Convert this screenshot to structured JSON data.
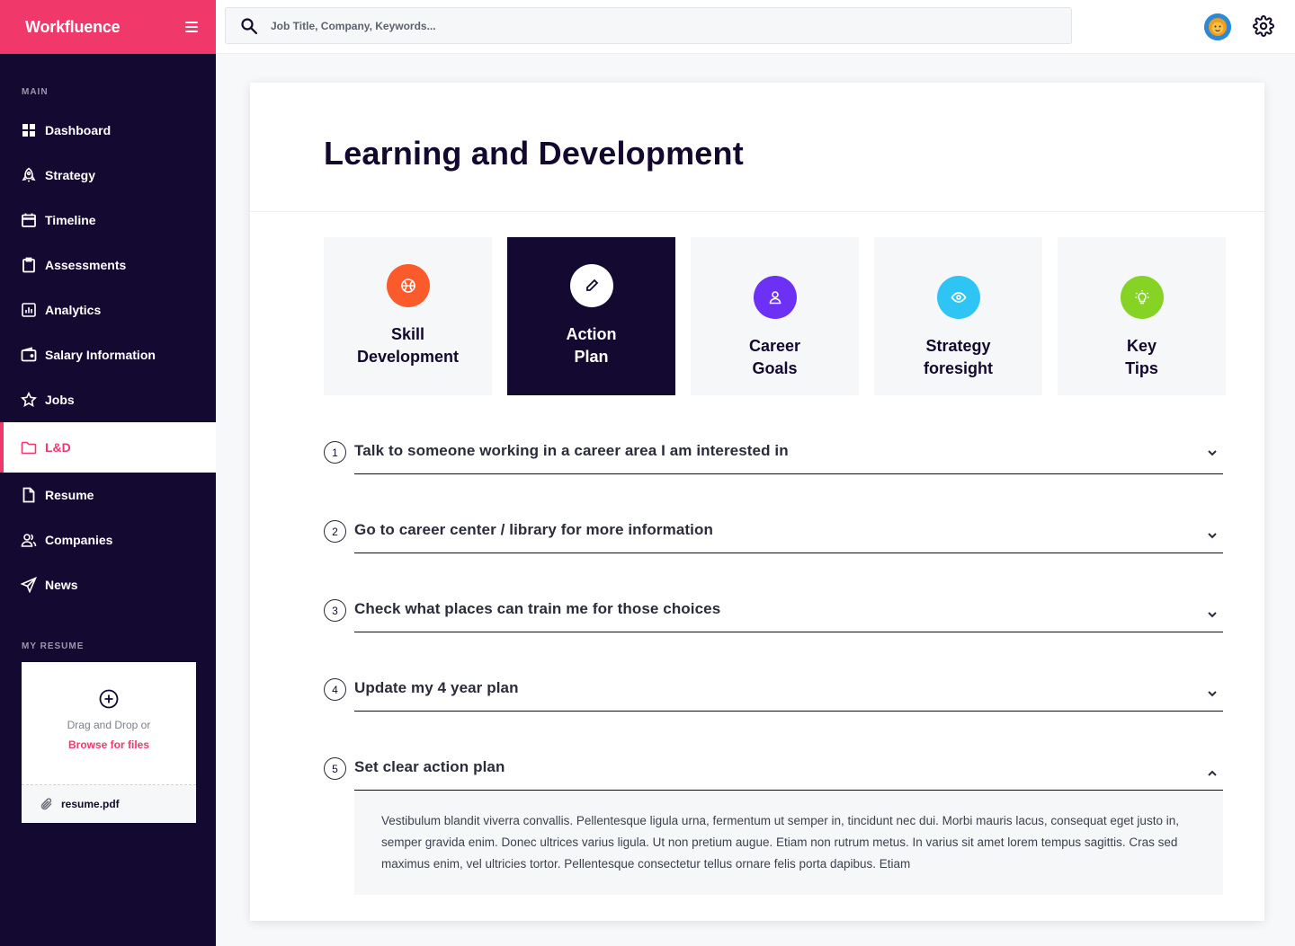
{
  "app": {
    "brand": "Workfluence"
  },
  "search": {
    "placeholder": "Job Title, Company, Keywords..."
  },
  "sidebar": {
    "main_label": "MAIN",
    "items": [
      {
        "label": "Dashboard",
        "icon": "grid-icon"
      },
      {
        "label": "Strategy",
        "icon": "rocket-icon"
      },
      {
        "label": "Timeline",
        "icon": "calendar-icon"
      },
      {
        "label": "Assessments",
        "icon": "clipboard-icon"
      },
      {
        "label": "Analytics",
        "icon": "bar-chart-icon"
      },
      {
        "label": "Salary Information",
        "icon": "wallet-icon"
      },
      {
        "label": "Jobs",
        "icon": "star-icon"
      },
      {
        "label": "L&D",
        "icon": "folder-icon",
        "active": true
      },
      {
        "label": "Resume",
        "icon": "file-icon"
      },
      {
        "label": "Companies",
        "icon": "users-icon"
      },
      {
        "label": "News",
        "icon": "send-icon"
      }
    ],
    "resume_label": "MY RESUME",
    "upload": {
      "drag_text": "Drag and Drop or",
      "browse_text": "Browse for files",
      "file_name": "resume.pdf"
    }
  },
  "page": {
    "title": "Learning and Development"
  },
  "tiles": [
    {
      "label_1": "Skill",
      "label_2": "Development",
      "icon": "basketball-icon",
      "color": "#fb5a2a"
    },
    {
      "label_1": "Action",
      "label_2": "Plan",
      "icon": "pencil-icon",
      "color": "#ffffff",
      "active": true
    },
    {
      "label_1": "Career",
      "label_2": "Goals",
      "icon": "user-icon",
      "color": "#6c31f5"
    },
    {
      "label_1": "Strategy",
      "label_2": "foresight",
      "icon": "eye-icon",
      "color": "#2ec5f5"
    },
    {
      "label_1": "Key",
      "label_2": "Tips",
      "icon": "lightbulb-icon",
      "color": "#86d325"
    }
  ],
  "steps": [
    {
      "num": "1",
      "title": "Talk to someone working  in a career area I am interested in"
    },
    {
      "num": "2",
      "title": "Go to career center / library for more information"
    },
    {
      "num": "3",
      "title": "Check what places can train me for those choices"
    },
    {
      "num": "4",
      "title": "Update my 4 year plan"
    },
    {
      "num": "5",
      "title": "Set clear action plan",
      "expanded": true,
      "body": "Vestibulum blandit viverra convallis. Pellentesque ligula urna, fermentum ut semper in, tincidunt nec dui. Morbi mauris lacus, consequat eget justo in, semper gravida enim. Donec ultrices varius ligula. Ut non pretium augue. Etiam non rutrum metus. In varius sit amet lorem tempus sagittis. Cras sed maximus enim, vel ultricies tortor. Pellentesque consectetur tellus ornare felis porta dapibus. Etiam"
    }
  ]
}
